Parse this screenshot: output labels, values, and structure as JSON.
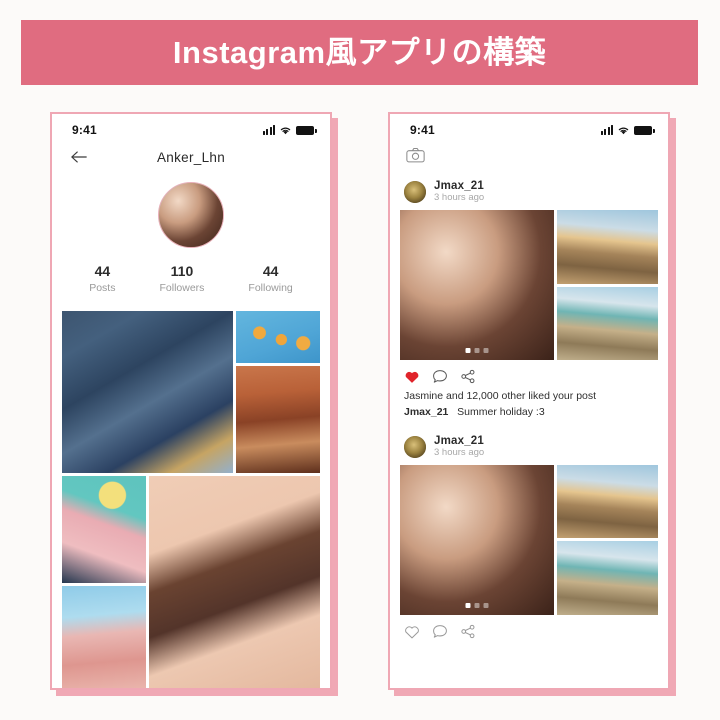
{
  "banner": {
    "title": "Instagram風アプリの構築",
    "bg_color": "#E06C80",
    "text_color": "#FFFFFF"
  },
  "canvas": {
    "background": "#FCFAF9",
    "phone_border_color": "#EFA7B4",
    "phone_shadow_color": "#F0A8B5"
  },
  "profile_screen": {
    "status_bar": {
      "time": "9:41",
      "icons": [
        "signal-icon",
        "wifi-icon",
        "battery-icon"
      ]
    },
    "nav": {
      "back_icon": "back-arrow-icon",
      "title": "Anker_Lhn"
    },
    "avatar": {
      "icon": "profile-avatar",
      "ring_color": "#E8AEB8"
    },
    "stats": [
      {
        "value": "44",
        "label": "Posts"
      },
      {
        "value": "110",
        "label": "Followers"
      },
      {
        "value": "44",
        "label": "Following"
      }
    ],
    "grid": [
      {
        "name": "grid-photo-architecture",
        "style": "ph-arch"
      },
      {
        "name": "grid-photo-citrus",
        "style": "ph-citrus"
      },
      {
        "name": "grid-photo-interior",
        "style": "ph-interior"
      },
      {
        "name": "grid-photo-cup",
        "style": "ph-cup"
      },
      {
        "name": "grid-photo-chocolate",
        "style": "ph-choco"
      },
      {
        "name": "grid-photo-pink-building",
        "style": "ph-pinkbld"
      }
    ]
  },
  "feed_screen": {
    "status_bar": {
      "time": "9:41",
      "icons": [
        "signal-icon",
        "wifi-icon",
        "battery-icon"
      ]
    },
    "toolbar": {
      "camera_icon": "camera-icon"
    },
    "posts": [
      {
        "user": "Jmax_21",
        "time": "3 hours ago",
        "carousel": {
          "count": 3,
          "active_index": 0
        },
        "liked": true,
        "like_color": "#E0242B",
        "actions": [
          "heart-icon",
          "comment-icon",
          "share-icon"
        ],
        "likes_text": "Jasmine and 12,000 other liked your post",
        "caption_user": "Jmax_21",
        "caption_text": "Summer holiday :3"
      },
      {
        "user": "Jmax_21",
        "time": "3 hours ago",
        "carousel": {
          "count": 3,
          "active_index": 0
        },
        "liked": false,
        "actions": [
          "heart-icon",
          "comment-icon",
          "share-icon"
        ]
      }
    ]
  }
}
